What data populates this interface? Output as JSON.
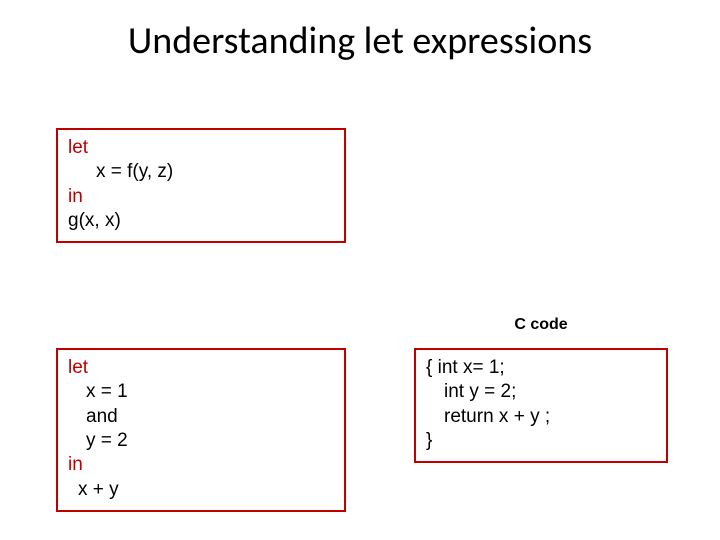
{
  "title": "Understanding let expressions",
  "box1": {
    "kw_let": "let",
    "line_assign": "x = f(y, z)",
    "kw_in": "in",
    "line_body": "g(x, x)"
  },
  "box2": {
    "kw_let": "let",
    "line_x": "x = 1",
    "line_and": "and",
    "line_y": "y = 2",
    "kw_in": "in",
    "line_body": "x + y"
  },
  "box3_label": "C code",
  "box3": {
    "l1": "{ int x= 1;",
    "l2": "int y = 2;",
    "l3": "return x + y ;",
    "l4": "}"
  }
}
